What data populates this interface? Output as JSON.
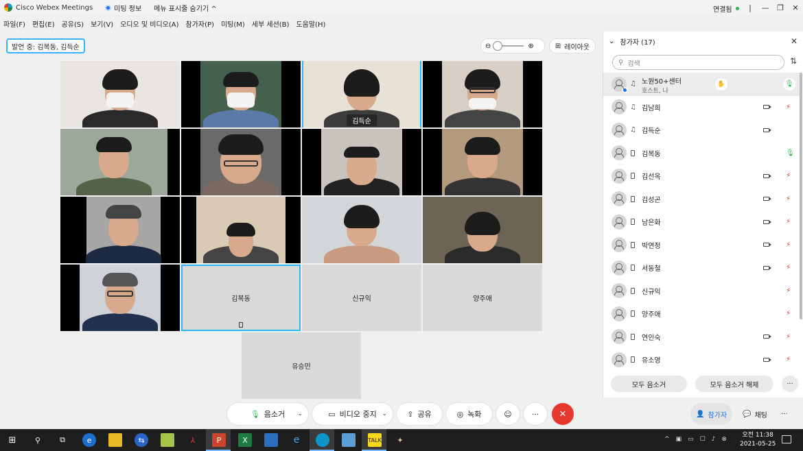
{
  "titlebar": {
    "app_title": "Cisco Webex Meetings",
    "meeting_info": "미팅 정보",
    "hide_menu": "메뉴 표시줄 숨기기",
    "connection_status": "연결됨"
  },
  "menubar": [
    "파일(F)",
    "편집(E)",
    "공유(S)",
    "보기(V)",
    "오디오 및 비디오(A)",
    "참가자(P)",
    "미팅(M)",
    "세부 세션(B)",
    "도움말(H)"
  ],
  "video": {
    "speaking_label": "발언 중: 김복동, 김득순",
    "layout_label": "레이아웃",
    "tiles": [
      {
        "type": "video",
        "name": ""
      },
      {
        "type": "video",
        "name": ""
      },
      {
        "type": "video",
        "name": "김득순",
        "active": true
      },
      {
        "type": "video",
        "name": ""
      },
      {
        "type": "video",
        "name": ""
      },
      {
        "type": "video",
        "name": ""
      },
      {
        "type": "video",
        "name": ""
      },
      {
        "type": "video",
        "name": ""
      },
      {
        "type": "video",
        "name": ""
      },
      {
        "type": "video",
        "name": ""
      },
      {
        "type": "video",
        "name": ""
      },
      {
        "type": "video",
        "name": ""
      },
      {
        "type": "video",
        "name": ""
      },
      {
        "type": "blank",
        "name": "김복동",
        "active": true
      },
      {
        "type": "blank",
        "name": "신규익"
      },
      {
        "type": "blank",
        "name": "양주애"
      },
      {
        "type": "blank",
        "name": "유승민"
      }
    ]
  },
  "panel": {
    "title": "참가자 (17)",
    "search_placeholder": "검색",
    "participants": [
      {
        "name": "노원50+센터",
        "sub": "호스트, 나",
        "device": "headset",
        "video": false,
        "mic": "on-pill"
      },
      {
        "name": "김남희",
        "device": "headset",
        "video": true,
        "mic": "muted"
      },
      {
        "name": "김득순",
        "device": "headset",
        "video": true,
        "mic": "none"
      },
      {
        "name": "김복동",
        "device": "phone",
        "video": false,
        "mic": "on"
      },
      {
        "name": "김선옥",
        "device": "phone",
        "video": true,
        "mic": "muted"
      },
      {
        "name": "김성곤",
        "device": "phone",
        "video": true,
        "mic": "muted"
      },
      {
        "name": "남은화",
        "device": "phone",
        "video": true,
        "mic": "muted"
      },
      {
        "name": "박연정",
        "device": "phone",
        "video": true,
        "mic": "muted"
      },
      {
        "name": "서동철",
        "device": "phone",
        "video": true,
        "mic": "muted"
      },
      {
        "name": "신규익",
        "device": "phone",
        "video": false,
        "mic": "muted"
      },
      {
        "name": "양주애",
        "device": "phone",
        "video": false,
        "mic": "muted"
      },
      {
        "name": "연인숙",
        "device": "phone",
        "video": true,
        "mic": "muted"
      },
      {
        "name": "유소영",
        "device": "phone",
        "video": true,
        "mic": "muted"
      }
    ],
    "mute_all": "모두 음소거",
    "unmute_all": "모두 음소거 해제"
  },
  "controls": {
    "mute": "음소거",
    "stop_video": "비디오 중지",
    "share": "공유",
    "record": "녹화",
    "participants": "참가자",
    "chat": "채팅"
  },
  "taskbar": {
    "time": "오전 11:38",
    "date": "2021-05-25"
  },
  "colors": {
    "accent": "#2db6f5",
    "end_call": "#e5392f",
    "mic_on": "#2bb24c",
    "mic_muted": "#e53935"
  }
}
